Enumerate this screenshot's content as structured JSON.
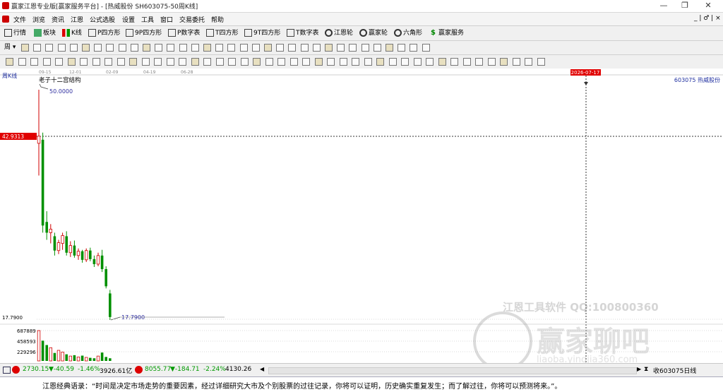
{
  "window": {
    "title": "赢家江恩专业版[赢家服务平台] - [热威股份  SH603075-50周K线]",
    "minimize_label": "—",
    "restore_label": "❐",
    "close_label": "✕",
    "inner_controls": "_ | ♂ | ×"
  },
  "menu": {
    "items": [
      "文件",
      "浏览",
      "资讯",
      "江恩",
      "公式选股",
      "设置",
      "工具",
      "窗口",
      "交易委托",
      "帮助"
    ]
  },
  "toolbar1": {
    "items": [
      "行情",
      "板块",
      "K线",
      "P四方形",
      "9P四方形",
      "P数字表",
      "T四方形",
      "9T四方形",
      "T数字表",
      "江恩轮",
      "赢家轮",
      "六角形",
      "赢家服务"
    ]
  },
  "toolbar2": {
    "period_label": "周"
  },
  "chart": {
    "period_label": "周K线",
    "stock_label": "603075  热威股份",
    "date_ticks": [
      "09-15",
      "12-01",
      "02-09",
      "04-19",
      "06-28"
    ],
    "cursor_date": "2026-07-17",
    "annotation": "老子十二宫结构",
    "high_label": "50.0000",
    "low_label": "17.7900",
    "left_price_red": "42.9313",
    "left_price_low": "17.7900",
    "volume_ticks": [
      "687889",
      "458593",
      "229296"
    ],
    "watermark": {
      "line1": "江恩工具软件  QQ:100800360",
      "line2": "赢家聊吧",
      "line3": "liaoba.yingjia360.com"
    }
  },
  "chart_data": {
    "type": "candlestick",
    "title": "老子十二宫结构",
    "xlabel": "",
    "ylabel": "",
    "x_ticks": [
      "09-15",
      "12-01",
      "02-09",
      "04-19",
      "06-28"
    ],
    "ylim": [
      17.79,
      50.0
    ],
    "candles": [
      {
        "o": 42.5,
        "h": 50.0,
        "l": 38.0,
        "c": 43.5
      },
      {
        "o": 43.0,
        "h": 44.0,
        "l": 30.0,
        "c": 31.0
      },
      {
        "o": 31.5,
        "h": 33.0,
        "l": 29.0,
        "c": 30.0
      },
      {
        "o": 30.0,
        "h": 31.2,
        "l": 28.5,
        "c": 30.5
      },
      {
        "o": 29.5,
        "h": 30.0,
        "l": 26.8,
        "c": 27.5
      },
      {
        "o": 27.5,
        "h": 29.0,
        "l": 27.0,
        "c": 28.6
      },
      {
        "o": 28.5,
        "h": 30.0,
        "l": 27.6,
        "c": 29.6
      },
      {
        "o": 29.5,
        "h": 30.2,
        "l": 26.8,
        "c": 27.2
      },
      {
        "o": 27.2,
        "h": 28.8,
        "l": 26.6,
        "c": 28.2
      },
      {
        "o": 28.2,
        "h": 28.9,
        "l": 26.5,
        "c": 26.8
      },
      {
        "o": 26.8,
        "h": 27.8,
        "l": 26.2,
        "c": 27.4
      },
      {
        "o": 27.4,
        "h": 27.6,
        "l": 25.8,
        "c": 26.2
      },
      {
        "o": 26.2,
        "h": 27.8,
        "l": 25.9,
        "c": 27.5
      },
      {
        "o": 27.5,
        "h": 27.9,
        "l": 26.0,
        "c": 26.3
      },
      {
        "o": 26.3,
        "h": 26.8,
        "l": 25.2,
        "c": 25.6
      },
      {
        "o": 25.6,
        "h": 27.2,
        "l": 25.3,
        "c": 26.8
      },
      {
        "o": 26.8,
        "h": 27.6,
        "l": 24.5,
        "c": 24.9
      },
      {
        "o": 24.9,
        "h": 25.3,
        "l": 22.2,
        "c": 22.5
      },
      {
        "o": 21.5,
        "h": 22.0,
        "l": 17.79,
        "c": 18.2
      }
    ],
    "volumes": [
      687889,
      458593,
      360000,
      300000,
      180000,
      240000,
      200000,
      150000,
      110000,
      130000,
      90000,
      120000,
      80000,
      70000,
      60000,
      110000,
      190000,
      90000,
      60000
    ],
    "volume_ticks": [
      687889,
      458593,
      229296
    ]
  },
  "status": {
    "sh_index": "2730.15",
    "sh_change": "▼-40.59",
    "sh_pct": "-1.46%",
    "sh_amount": "3926.61亿",
    "sz_index": "8055.77",
    "sz_change": "▼-184.71",
    "sz_pct": "-2.24%",
    "sz_amount": "4130.26",
    "right_label": "收603075日线"
  },
  "quote": {
    "text": "江恩经典语录：“时间是决定市场走势的重要因素，经过详细研究大市及个别股票的过往记录，你将可以证明，历史确实重复发生；而了解过往，你将可以预测将来。”。"
  },
  "colors": {
    "up": "#d00000",
    "down": "#009000",
    "accent_blue": "#2030a0",
    "price_red_bg": "#e00000"
  }
}
